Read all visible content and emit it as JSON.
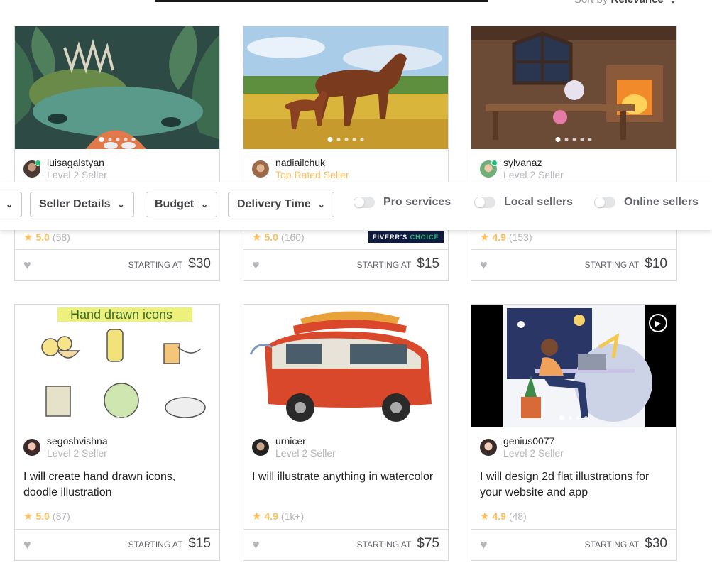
{
  "sort": {
    "prefix": "Sort by",
    "value": "Relevance"
  },
  "filters": {
    "buttons": [
      "Seller Details",
      "Budget",
      "Delivery Time"
    ],
    "toggles": [
      "Pro services",
      "Local sellers",
      "Online sellers"
    ]
  },
  "badge": {
    "brand": "FIVERR'S",
    "label": "CHOICE"
  },
  "price_label": "STARTING AT",
  "gigs": [
    {
      "seller": "luisagalstyan",
      "level": "Level 2 Seller",
      "rating": "5.0",
      "reviews": "(58)",
      "price": "$30"
    },
    {
      "seller": "nadiailchuk",
      "level": "Top Rated Seller",
      "rating": "5.0",
      "reviews": "(160)",
      "price": "$15"
    },
    {
      "seller": "sylvanaz",
      "level": "Level 2 Seller",
      "rating": "4.9",
      "reviews": "(153)",
      "price": "$10"
    },
    {
      "seller": "segoshvishna",
      "level": "Level 2 Seller",
      "title": "I will create hand drawn icons, doodle illustration",
      "rating": "5.0",
      "reviews": "(87)",
      "price": "$15",
      "image_text": "Hand drawn icons"
    },
    {
      "seller": "urnicer",
      "level": "Level 2 Seller",
      "title": "I will illustrate anything in watercolor",
      "rating": "4.9",
      "reviews": "(1k+)",
      "price": "$75"
    },
    {
      "seller": "genius0077",
      "level": "Level 2 Seller",
      "title": "I will design 2d flat illustrations for your website and app",
      "rating": "4.9",
      "reviews": "(48)",
      "price": "$30"
    }
  ]
}
